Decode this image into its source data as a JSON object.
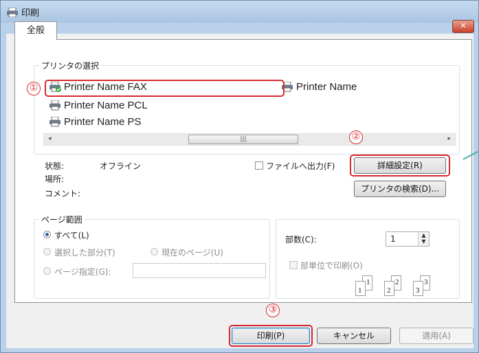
{
  "window": {
    "title": "印刷",
    "close_symbol": "✕"
  },
  "tab": {
    "label": "全般"
  },
  "printer_group": {
    "label": "プリンタの選択",
    "printers": [
      "Printer Name FAX",
      "Printer Name",
      "Printer Name PCL",
      "Printer Name PS"
    ],
    "selected": "Printer Name FAX",
    "scroll_thumb_glyph": "|||",
    "scroll_left": "◂",
    "scroll_right": "▸"
  },
  "status": {
    "state_label": "状態:",
    "state_value": "オフライン",
    "location_label": "場所:",
    "comment_label": "コメント:",
    "print_to_file": "ファイルへ出力(F)",
    "preferences_button": "詳細設定(R)",
    "find_printer_button": "プリンタの検索(D)..."
  },
  "page_range": {
    "label": "ページ範囲",
    "all": "すべて(L)",
    "selection": "選択した部分(T)",
    "current_page": "現在のページ(U)",
    "pages": "ページ指定(G):"
  },
  "copies": {
    "label": "部数(C):",
    "value": "1",
    "collate": "部単位で印刷(O)",
    "collate_pages": [
      "1",
      "1",
      "2",
      "2",
      "3",
      "3"
    ]
  },
  "buttons": {
    "print": "印刷(P)",
    "cancel": "キャンセル",
    "apply": "適用(A)"
  },
  "annotations": {
    "one": "①",
    "two": "②",
    "three": "③"
  },
  "colors": {
    "annotation_red": "#d7282f",
    "window_frame": "#b9d1ea",
    "accent_teal": "#3fb3a6"
  }
}
